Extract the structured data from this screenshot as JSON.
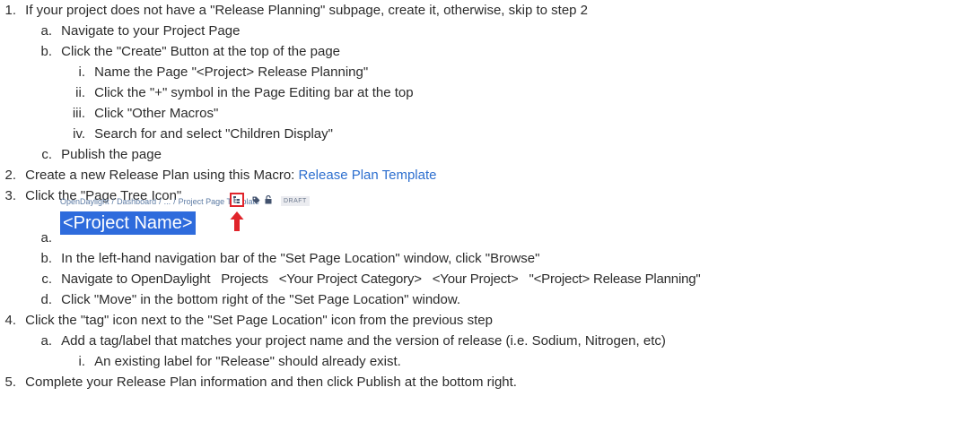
{
  "steps": [
    {
      "marker": "1.",
      "text": "If your project does not have a \"Release Planning\" subpage, create it, otherwise, skip to step 2"
    },
    {
      "marker": "a.",
      "text": "Navigate to your Project Page"
    },
    {
      "marker": "b.",
      "text": "Click the \"Create\" Button at the top of the page"
    },
    {
      "marker": "i.",
      "text": "Name the Page \"<Project> Release Planning\""
    },
    {
      "marker": "ii.",
      "text": "Click the \"+\" symbol in the Page Editing bar at the top"
    },
    {
      "marker": "iii.",
      "text": "Click \"Other Macros\""
    },
    {
      "marker": "iv.",
      "text": "Search for and select \"Children Display\""
    },
    {
      "marker": "c.",
      "text": "Publish the page"
    },
    {
      "marker": "2.",
      "text": "Create a new Release Plan using this Macro: ",
      "link": "Release Plan Template"
    },
    {
      "marker": "3.",
      "text": "Click the \"Page Tree Icon\""
    },
    {
      "marker": "a.",
      "text": ""
    },
    {
      "marker": "b.",
      "text": "In the left-hand navigation bar of the \"Set Page Location\" window, click \"Browse\""
    },
    {
      "marker": "c.",
      "text": "Navigate to OpenDaylight   Projects   <Your Project Category>   <Your Project>   \"<Project> Release Planning\""
    },
    {
      "marker": "d.",
      "text": "Click \"Move\" in the bottom right of the \"Set Page Location\" window."
    },
    {
      "marker": "4.",
      "text": "Click the \"tag\" icon next to the \"Set Page Location\" icon from the previous step"
    },
    {
      "marker": "a.",
      "text": "Add a tag/label that matches your project name and the version of release (i.e. Sodium, Nitrogen, etc)"
    },
    {
      "marker": "i.",
      "text": "An existing label for \"Release\" should already exist."
    },
    {
      "marker": "5.",
      "text": "Complete your Release Plan information and then click Publish at the bottom right."
    }
  ],
  "screenshot": {
    "breadcrumbs": [
      "OpenDaylight",
      "/",
      "Dashboard",
      "/",
      "...",
      "/",
      "Project Page Template"
    ],
    "draft_label": "DRAFT",
    "page_title": "<Project Name>",
    "icons": [
      "page-tree-icon",
      "tag-icon",
      "lock-icon",
      "up-arrow-icon"
    ],
    "colors": {
      "highlight": "#2e6bdc",
      "callout": "#e0242b",
      "link": "#2d6fcf"
    }
  }
}
